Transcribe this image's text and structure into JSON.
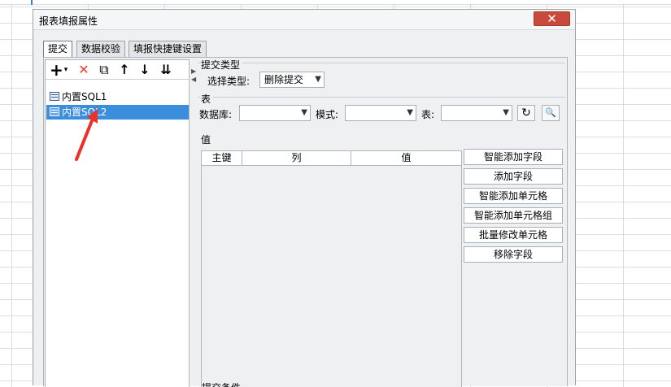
{
  "dialog": {
    "title": "报表填报属性",
    "close_glyph": "✕"
  },
  "tabs": [
    {
      "label": "提交",
      "active": true
    },
    {
      "label": "数据校验",
      "active": false
    },
    {
      "label": "填报快捷键设置",
      "active": false
    }
  ],
  "toolbar": {
    "add": "+",
    "add_caret": "▾",
    "delete": "✕",
    "copy": "⧉",
    "up": "↑",
    "down": "↓",
    "bottom": "⇊"
  },
  "tree": {
    "items": [
      {
        "label": "内置SQL1",
        "selected": false
      },
      {
        "label": "内置SQL2",
        "selected": true
      }
    ]
  },
  "submit_type": {
    "section_label": "提交类型",
    "select_label": "选择类型:",
    "value": "删除提交"
  },
  "table_section": {
    "section_label": "表",
    "database_label": "数据库:",
    "database_value": "",
    "schema_label": "模式:",
    "schema_value": "",
    "table_label": "表:",
    "table_value": "",
    "refresh_glyph": "↻",
    "preview_glyph": "🔍"
  },
  "value_section": {
    "section_label": "值",
    "columns": [
      "主键",
      "列",
      "值"
    ],
    "rows": []
  },
  "side_buttons": [
    "智能添加字段",
    "添加字段",
    "智能添加单元格",
    "智能添加单元格组",
    "批量修改单元格",
    "移除字段"
  ],
  "condition_section": {
    "section_label": "提交条件"
  },
  "colors": {
    "selection": "#3b8ede",
    "close_button": "#c84a3a",
    "delete_icon": "#e23a2e",
    "annotation_arrow": "#e8322a"
  }
}
